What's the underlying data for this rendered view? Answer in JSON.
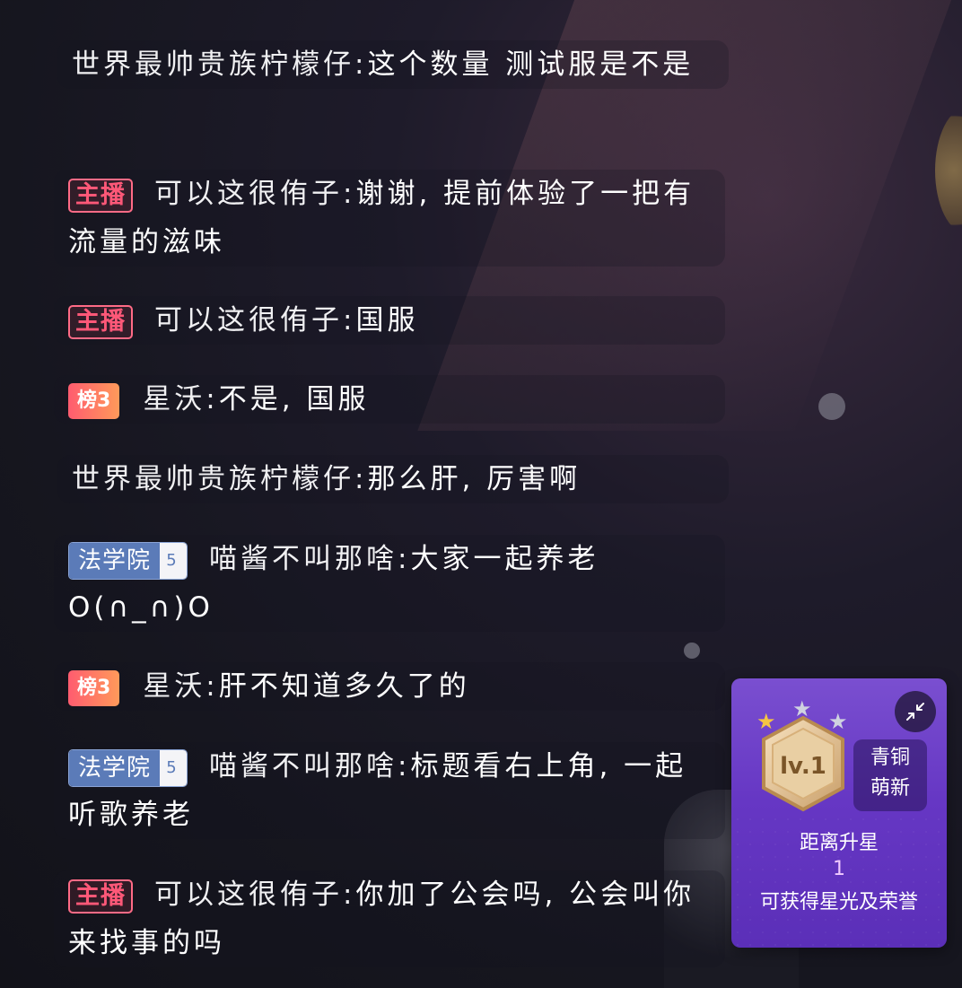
{
  "chat": {
    "messages": [
      {
        "badge": null,
        "user": "世界最帅贵族柠檬仔:",
        "text": "这个数量 测试服是不是"
      },
      {
        "badge": {
          "type": "host",
          "label": "主播"
        },
        "user": "可以这很侑子:",
        "text": "谢谢, 提前体验了一把有流量的滋味"
      },
      {
        "badge": {
          "type": "host",
          "label": "主播"
        },
        "user": "可以这很侑子:",
        "text": "国服"
      },
      {
        "badge": {
          "type": "rank",
          "label": "榜3"
        },
        "user": "星沃:",
        "text": "不是, 国服"
      },
      {
        "badge": null,
        "user": "世界最帅贵族柠檬仔:",
        "text": "那么肝, 厉害啊"
      },
      {
        "badge": {
          "type": "fan",
          "label": "法学院",
          "level": "5"
        },
        "user": "喵酱不叫那啥:",
        "text": "大家一起养老O(∩_∩)O"
      },
      {
        "badge": {
          "type": "rank",
          "label": "榜3"
        },
        "user": "星沃:",
        "text": "肝不知道多久了的"
      },
      {
        "badge": {
          "type": "fan",
          "label": "法学院",
          "level": "5"
        },
        "user": "喵酱不叫那啥:",
        "text": "标题看右上角, 一起听歌养老"
      },
      {
        "badge": {
          "type": "host",
          "label": "主播"
        },
        "user": "可以这很侑子:",
        "text": "你加了公会吗, 公会叫你来找事的吗"
      }
    ]
  },
  "level_panel": {
    "level_label": "lv.1",
    "stars": 3,
    "tier_line1": "青铜",
    "tier_line2": "萌新",
    "distance_label": "距离升星",
    "distance_value": "1",
    "reward_label": "可获得星光及荣誉",
    "collapse_icon": "collapse-arrows-icon"
  },
  "colors": {
    "host_badge": "#ff5878",
    "rank_badge_start": "#ff5c6f",
    "rank_badge_end": "#ff9a5a",
    "fan_badge": "#5b7bb8",
    "panel_purple": "#6637c4"
  }
}
